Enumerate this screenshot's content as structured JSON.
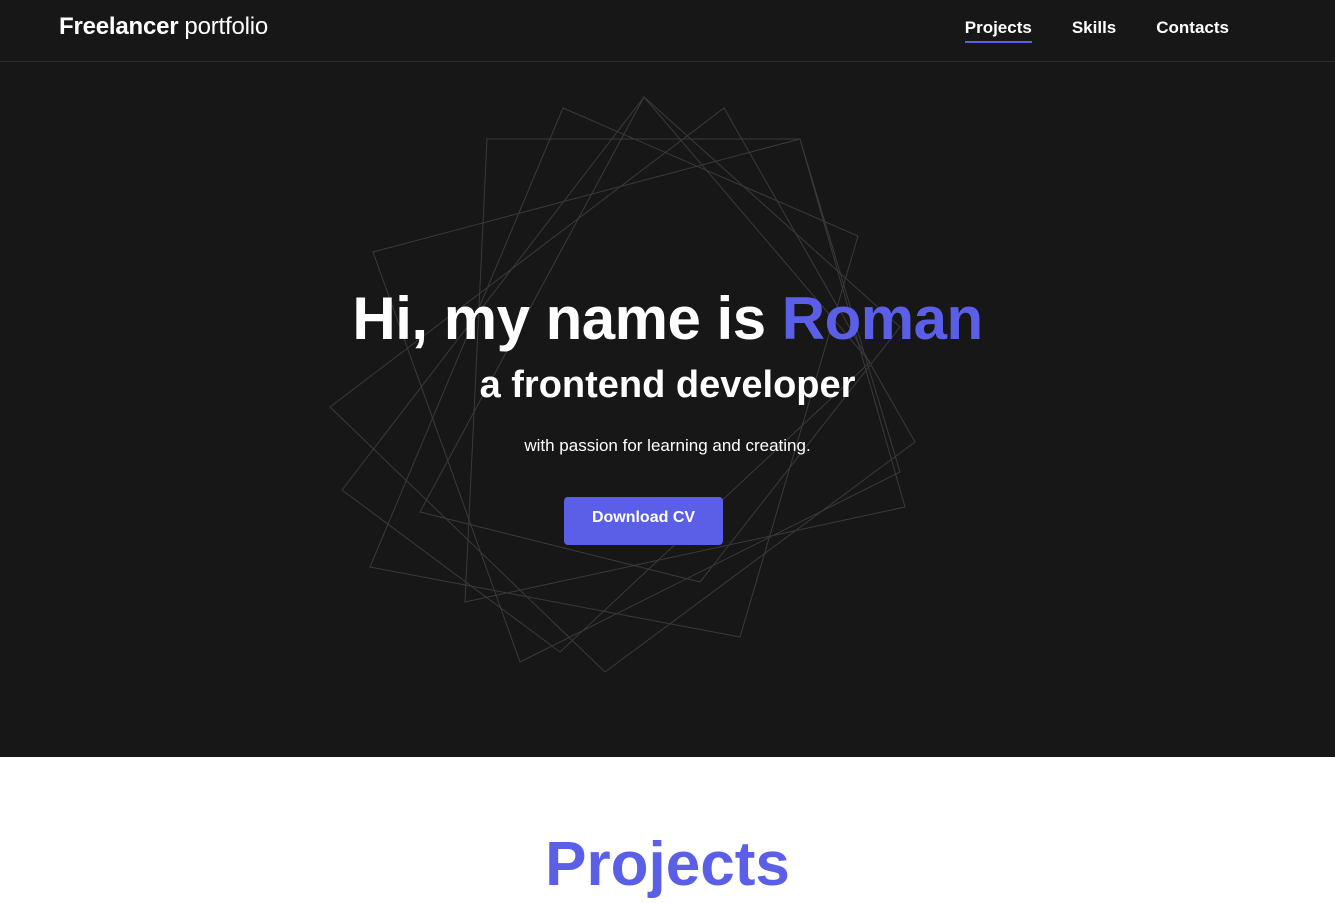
{
  "header": {
    "logo_strong": "Freelancer",
    "logo_light": "portfolio",
    "nav": [
      {
        "label": "Projects",
        "active": true
      },
      {
        "label": "Skills",
        "active": false
      },
      {
        "label": "Contacts",
        "active": false
      }
    ]
  },
  "hero": {
    "title_prefix": "Hi, my name is ",
    "title_name": "Roman",
    "subtitle": "a frontend developer",
    "tagline": "with passion for learning and creating.",
    "cta_label": "Download CV"
  },
  "projects": {
    "title": "Projects"
  },
  "colors": {
    "background_dark": "#171717",
    "accent": "#5b5fe8",
    "text_light": "#ffffff"
  }
}
